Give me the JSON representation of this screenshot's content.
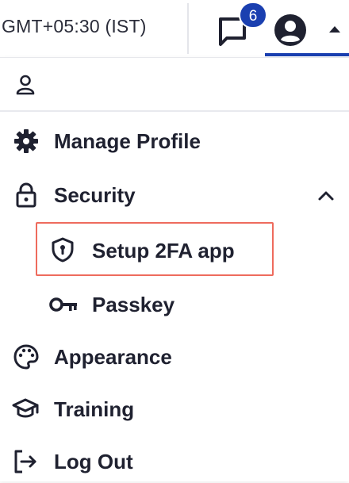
{
  "header": {
    "timezone": "GMT+05:30 (IST)",
    "messages_badge": "6",
    "icons": [
      "chat-icon",
      "user-avatar-icon",
      "caret-up-icon"
    ]
  },
  "menu": {
    "user_icon": "person-outline-icon",
    "items": [
      {
        "label": "Manage Profile",
        "icon": "gear-icon"
      },
      {
        "label": "Security",
        "icon": "lock-icon",
        "expanded": true,
        "children": [
          {
            "label": "Setup 2FA app",
            "icon": "shield-keyhole-icon",
            "highlighted": true
          },
          {
            "label": "Passkey",
            "icon": "key-icon"
          }
        ]
      },
      {
        "label": "Appearance",
        "icon": "palette-icon"
      },
      {
        "label": "Training",
        "icon": "graduation-cap-icon"
      },
      {
        "label": "Log Out",
        "icon": "logout-icon"
      }
    ]
  },
  "colors": {
    "accent": "#1a3fb0",
    "highlight_border": "#ee6b5d",
    "text": "#1f2130"
  }
}
